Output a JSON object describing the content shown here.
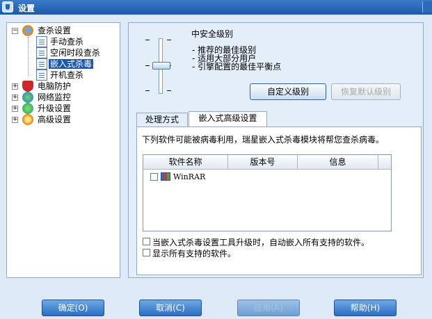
{
  "window": {
    "title": "设置"
  },
  "tree": [
    {
      "label": "查杀设置",
      "icon": "magnifier-icon",
      "expanded": true
    },
    {
      "label": "手动查杀",
      "icon": "doc-icon"
    },
    {
      "label": "空闲时段查杀",
      "icon": "doc-icon"
    },
    {
      "label": "嵌入式杀毒",
      "icon": "doc-icon",
      "selected": true
    },
    {
      "label": "开机查杀",
      "icon": "doc-icon"
    },
    {
      "label": "电脑防护",
      "icon": "shield-icon"
    },
    {
      "label": "网络监控",
      "icon": "globe-icon"
    },
    {
      "label": "升级设置",
      "icon": "upgrade-icon"
    },
    {
      "label": "高级设置",
      "icon": "gear-icon"
    }
  ],
  "security": {
    "level_title": "中安全级别",
    "level_desc": [
      "- 推荐的最佳级别",
      "- 适用大部分用户",
      "- 引擎配置的最佳平衡点"
    ],
    "custom_button": "自定义级别",
    "restore_button": "恢复默认级别"
  },
  "tabs": [
    "处理方式",
    "嵌入式高级设置"
  ],
  "tab_content": {
    "info": "下列软件可能被病毒利用，瑞星嵌入式杀毒模块将帮您查杀病毒。",
    "columns": [
      "软件名称",
      "版本号",
      "信息"
    ],
    "rows": [
      {
        "name": "WinRAR",
        "checked": false
      }
    ],
    "options": [
      "当嵌入式杀毒设置工具升级时，自动嵌入所有支持的软件。",
      "显示所有支持的软件。"
    ]
  },
  "buttons": {
    "ok": "确定(O)",
    "cancel": "取消(C)",
    "apply": "应用(A)",
    "help": "帮助(H)"
  }
}
